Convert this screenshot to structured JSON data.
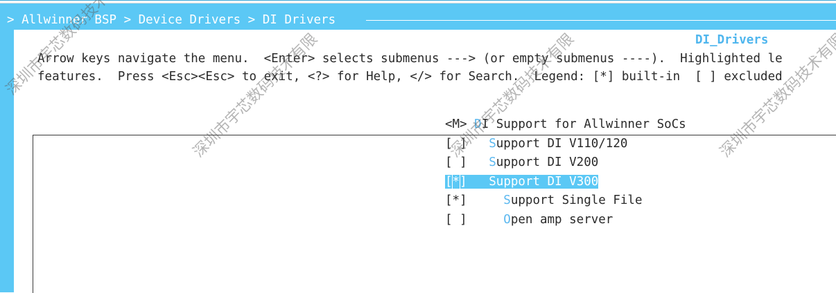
{
  "breadcrumb": "> Allwinner BSP > Device Drivers > DI Drivers",
  "dialog": {
    "title": "DI_Drivers",
    "help_line1": "Arrow keys navigate the menu.  <Enter> selects submenus ---> (or empty submenus ----).  Highlighted le",
    "help_line2": "features.  Press <Esc><Esc> to exit, <?> for Help, </> for Search.  Legend: [*] built-in  [ ] excluded"
  },
  "menu": {
    "items": [
      {
        "prefix": "<M> ",
        "hot": "D",
        "rest": "I Support for Allwinner SoCs"
      },
      {
        "prefix": "[ ]   ",
        "hot": "S",
        "rest": "upport DI V110/120"
      },
      {
        "prefix": "[ ]   ",
        "hot": "S",
        "rest": "upport DI V200"
      },
      {
        "prefix_open": "[",
        "prefix_mark": "*",
        "prefix_close": "]   ",
        "hot": "S",
        "rest": "upport DI V300"
      },
      {
        "prefix": "[*]     ",
        "hot": "S",
        "rest": "upport Single File"
      },
      {
        "prefix": "[ ]     ",
        "hot": "O",
        "rest": "pen amp server"
      }
    ]
  },
  "watermark": "深圳市宇芯数码技术有限"
}
